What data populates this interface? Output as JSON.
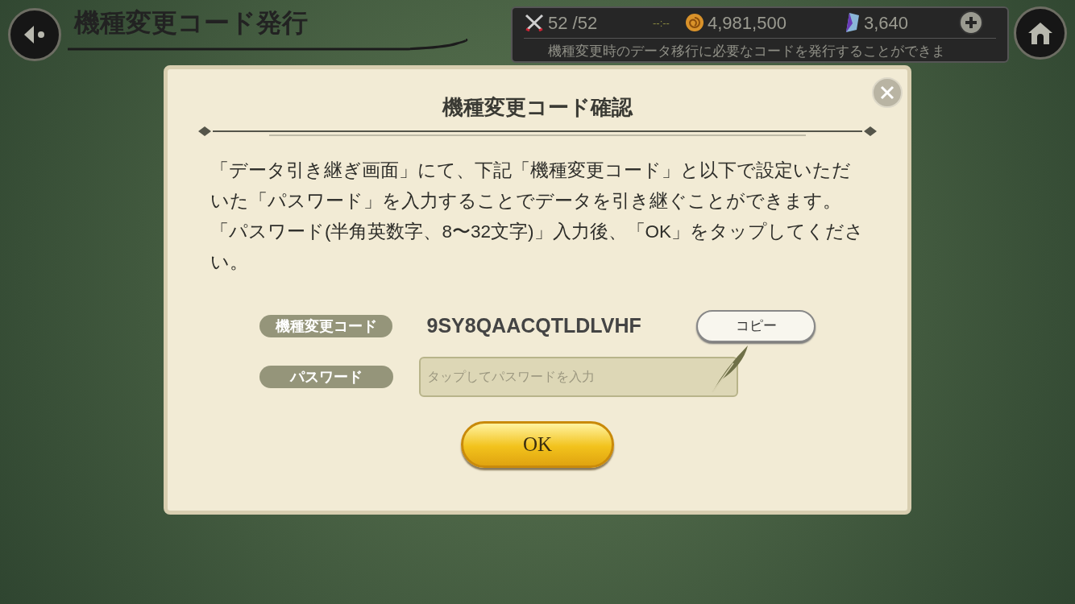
{
  "header": {
    "title": "機種変更コード発行"
  },
  "status_bar": {
    "stamina": "52 /52",
    "timer": "--:--",
    "coins": "4,981,500",
    "gems": "3,640",
    "ticker": "機種変更時のデータ移行に必要なコードを発行することができま"
  },
  "dialog": {
    "title": "機種変更コード確認",
    "paragraphs": [
      "「データ引き継ぎ画面」にて、下記「機種変更コード」と以下で設定いただいた「パスワード」を入力することでデータを引き継ぐことができます。",
      "「パスワード(半角英数字、8〜32文字)」入力後、「OK」をタップしてください。"
    ],
    "code_label": "機種変更コード",
    "code_value": "9SY8QAACQTLDLVHF",
    "copy_button": "コピー",
    "password_label": "パスワード",
    "password_placeholder": "タップしてパスワードを入力",
    "ok_button": "OK"
  }
}
